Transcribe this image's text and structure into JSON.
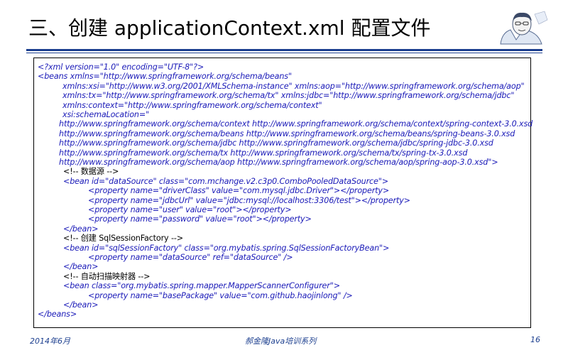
{
  "slide": {
    "title": "三、创建 applicationContext.xml 配置文件",
    "code_lines": [
      {
        "text": "<?xml version=\"1.0\" encoding=\"UTF-8\"?>",
        "indent": 5,
        "color": "blue"
      },
      {
        "text": "<beans xmlns=\"http://www.springframework.org/schema/beans\"",
        "indent": 5,
        "color": "blue"
      },
      {
        "text": "xmlns:xsi=\"http://www.w3.org/2001/XMLSchema-instance\" xmlns:aop=\"http://www.springframework.org/schema/aop\"",
        "indent": 40,
        "color": "blue"
      },
      {
        "text": "xmlns:tx=\"http://www.springframework.org/schema/tx\" xmlns:jdbc=\"http://www.springframework.org/schema/jdbc\"",
        "indent": 40,
        "color": "blue"
      },
      {
        "text": "xmlns:context=\"http://www.springframework.org/schema/context\"",
        "indent": 40,
        "color": "blue"
      },
      {
        "text": "xsi:schemaLocation=\"",
        "indent": 40,
        "color": "blue"
      },
      {
        "text": "http://www.springframework.org/schema/context http://www.springframework.org/schema/context/spring-context-3.0.xsd",
        "indent": 35,
        "color": "blue"
      },
      {
        "text": "http://www.springframework.org/schema/beans http://www.springframework.org/schema/beans/spring-beans-3.0.xsd",
        "indent": 35,
        "color": "blue"
      },
      {
        "text": "http://www.springframework.org/schema/jdbc http://www.springframework.org/schema/jdbc/spring-jdbc-3.0.xsd",
        "indent": 35,
        "color": "blue"
      },
      {
        "text": "http://www.springframework.org/schema/tx http://www.springframework.org/schema/tx/spring-tx-3.0.xsd",
        "indent": 35,
        "color": "blue"
      },
      {
        "text": "http://www.springframework.org/schema/aop http://www.springframework.org/schema/aop/spring-aop-3.0.xsd\">",
        "indent": 35,
        "color": "blue"
      },
      {
        "text": "<!--  数据源  -->",
        "indent": 41,
        "color": "black"
      },
      {
        "text": "<bean id=\"dataSource\" class=\"com.mchange.v2.c3p0.ComboPooledDataSource\">",
        "indent": 41,
        "color": "blue"
      },
      {
        "text": "<property name=\"driverClass\" value=\"com.mysql.jdbc.Driver\"></property>",
        "indent": 76,
        "color": "blue"
      },
      {
        "text": "<property name=\"jdbcUrl\" value=\"jdbc:mysql://localhost:3306/test\"></property>",
        "indent": 76,
        "color": "blue"
      },
      {
        "text": "<property name=\"user\" value=\"root\"></property>",
        "indent": 76,
        "color": "blue"
      },
      {
        "text": "<property name=\"password\" value=\"root\"></property>",
        "indent": 76,
        "color": "blue"
      },
      {
        "text": "</bean>",
        "indent": 41,
        "color": "blue"
      },
      {
        "text": "<!--  创建 SqlSessionFactory -->",
        "indent": 41,
        "color": "black"
      },
      {
        "text": "<bean id=\"sqlSessionFactory\" class=\"org.mybatis.spring.SqlSessionFactoryBean\">",
        "indent": 41,
        "color": "blue"
      },
      {
        "text": "<property name=\"dataSource\" ref=\"dataSource\" />",
        "indent": 76,
        "color": "blue"
      },
      {
        "text": "</bean>",
        "indent": 41,
        "color": "blue"
      },
      {
        "text": "<!--  自动扫描映射器  -->",
        "indent": 41,
        "color": "black"
      },
      {
        "text": "<bean class=\"org.mybatis.spring.mapper.MapperScannerConfigurer\">",
        "indent": 41,
        "color": "blue"
      },
      {
        "text": "<property name=\"basePackage\" value=\"com.github.haojinlong\" />",
        "indent": 76,
        "color": "blue"
      },
      {
        "text": "</bean>",
        "indent": 41,
        "color": "blue"
      },
      {
        "text": "</beans>",
        "indent": 5,
        "color": "blue"
      }
    ]
  },
  "footer": {
    "date": "2014年6月",
    "series": "郝金隆Java培训系列",
    "page_number": "16"
  },
  "colors": {
    "accent": "#1c3f8f",
    "code_blue": "#1a1ab8",
    "code_black": "#000000"
  },
  "icons": {
    "portrait": "author-portrait-icon"
  }
}
